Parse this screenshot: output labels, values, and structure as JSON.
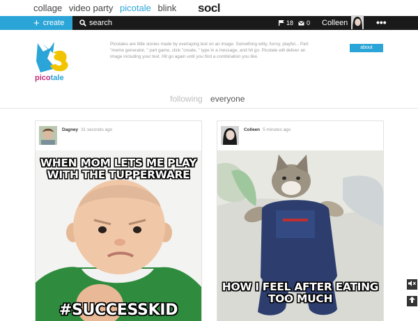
{
  "topnav": {
    "links": [
      "collage",
      "video party",
      "picotale",
      "blink"
    ],
    "active_link": "picotale",
    "logo": "socl"
  },
  "cmdbar": {
    "create_label": "create",
    "search_label": "search",
    "followers_count": "18",
    "messages_count": "0",
    "username": "Colleen",
    "more_label": "•••",
    "accent_color": "#2ba5d8"
  },
  "app": {
    "name_part1": "pico",
    "name_part2": "tale",
    "description": "Picotales are little stories made by overlaying text on an image. Something witty, funny, playful... Part \"meme generator, \" part game, click \"create, \" type in a message, and hit go. Picotale will deliver an image including your text. Hit go again until you find a combination you like.",
    "about_label": "about"
  },
  "tabs": {
    "following": "following",
    "everyone": "everyone",
    "active": "everyone"
  },
  "posts": [
    {
      "author": "Dagney",
      "time": "31 seconds ago",
      "top_text": "WHEN MOM LETS ME PLAY WITH THE TUPPERWARE",
      "bottom_text": "#SUCCESSKID"
    },
    {
      "author": "Colleen",
      "time": "5 minutes ago",
      "top_text": "",
      "bottom_text": "HOW I FEEL AFTER EATING TOO MUCH"
    }
  ],
  "side": {
    "mute_icon": "speaker-mute-icon",
    "up_icon": "arrow-up-icon"
  }
}
